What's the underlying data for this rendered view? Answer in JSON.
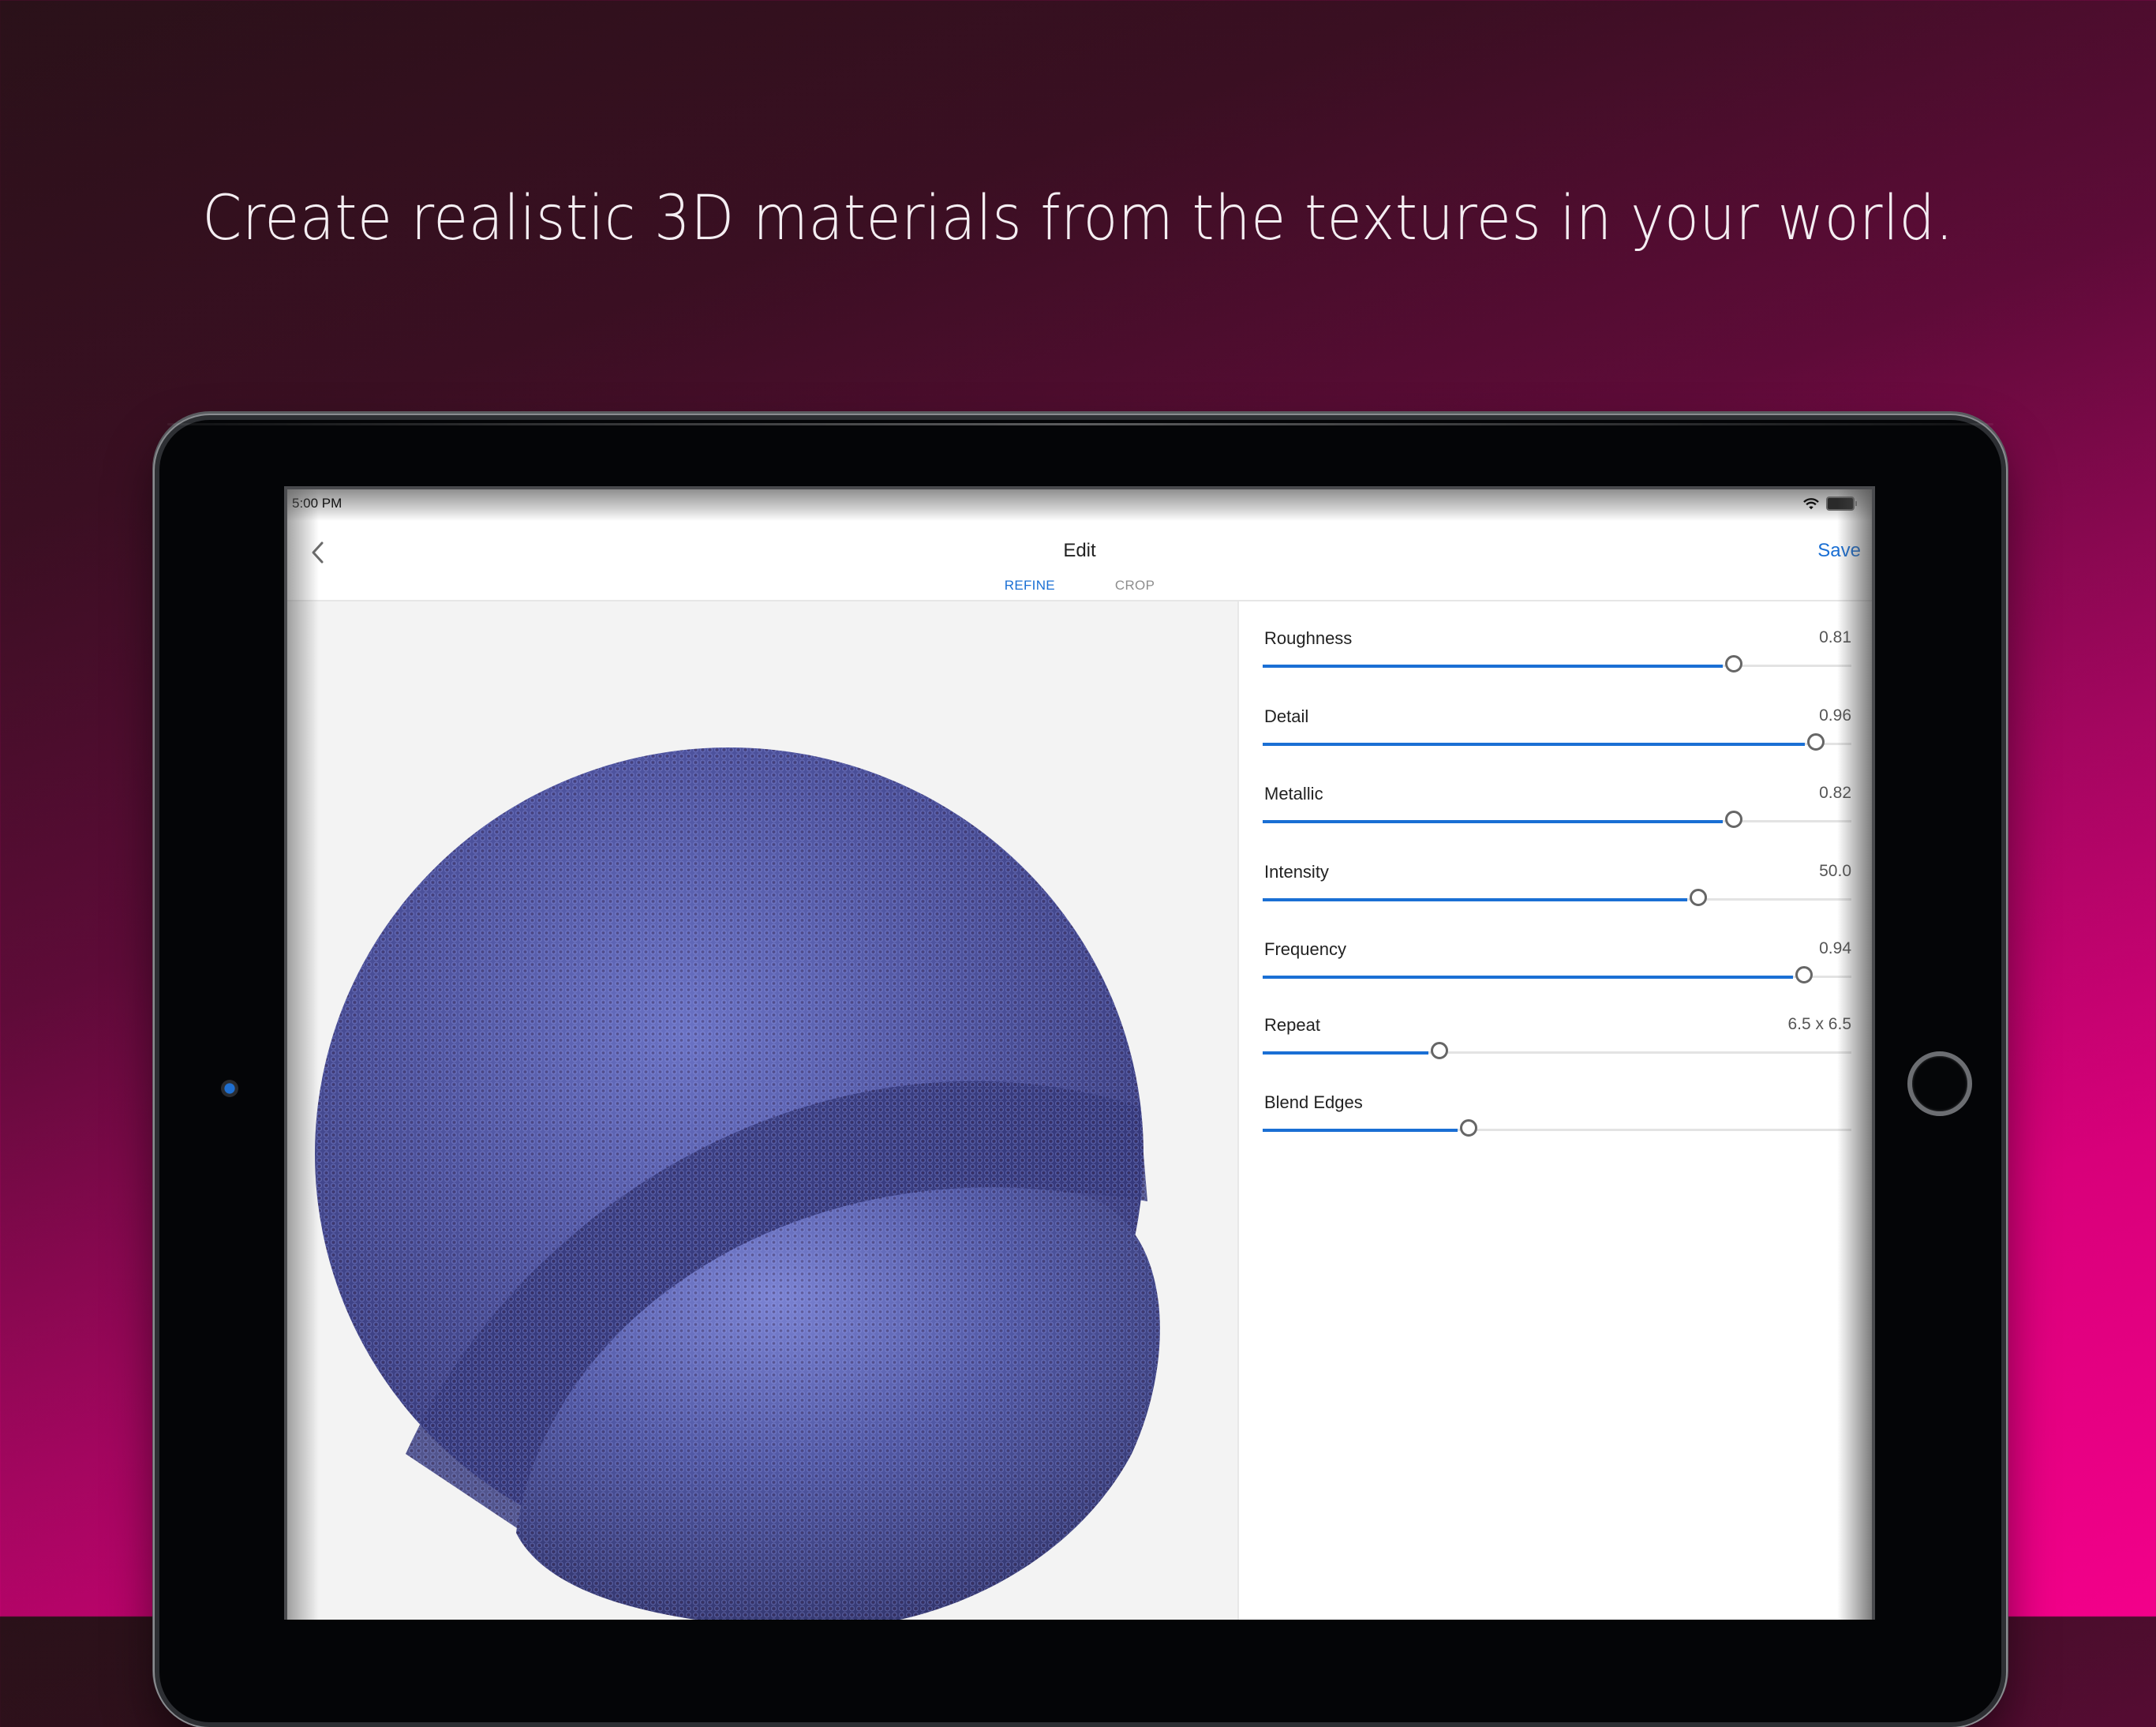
{
  "headline": "Create realistic 3D materials from the textures in your world.",
  "colors": {
    "accent": "#1a6fd4",
    "background_start": "#2a1119",
    "background_end": "#f3008a",
    "material_base": "#4a4f9c"
  },
  "status_bar": {
    "time": "5:00 PM",
    "wifi_icon": "wifi-icon",
    "battery_icon": "battery-icon"
  },
  "nav": {
    "back_icon": "chevron-left-icon",
    "title": "Edit",
    "save_label": "Save",
    "tabs": [
      {
        "label": "REFINE",
        "active": true
      },
      {
        "label": "CROP",
        "active": false
      }
    ]
  },
  "preview": {
    "subject": "sphere-material-preview"
  },
  "sliders": [
    {
      "label": "Roughness",
      "value_text": "0.81",
      "fraction": 0.8
    },
    {
      "label": "Detail",
      "value_text": "0.96",
      "fraction": 0.94
    },
    {
      "label": "Metallic",
      "value_text": "0.82",
      "fraction": 0.8
    },
    {
      "label": "Intensity",
      "value_text": "50.0",
      "fraction": 0.74
    },
    {
      "label": "Frequency",
      "value_text": "0.94",
      "fraction": 0.92
    },
    {
      "label": "Repeat",
      "value_text": "6.5 x 6.5",
      "fraction": 0.3
    },
    {
      "label": "Blend Edges",
      "value_text": "",
      "fraction": 0.35
    }
  ]
}
